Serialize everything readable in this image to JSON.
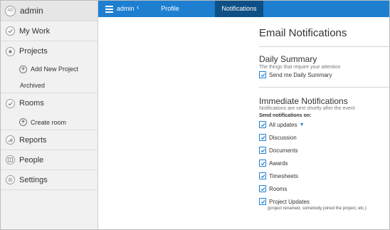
{
  "sidebar": {
    "user": {
      "avatar": "AD",
      "name": "admin"
    },
    "items": [
      {
        "label": "My Work",
        "icon": "check-icon"
      },
      {
        "label": "Projects",
        "icon": "projects-icon"
      },
      {
        "label": "Rooms",
        "icon": "check-icon"
      },
      {
        "label": "Reports",
        "icon": "reports-icon"
      },
      {
        "label": "People",
        "icon": "people-icon"
      },
      {
        "label": "Settings",
        "icon": "gear-icon"
      }
    ],
    "projects_sub": {
      "add": "Add New Project",
      "archived": "Archived"
    },
    "rooms_sub": {
      "create": "Create room"
    }
  },
  "topbar": {
    "user": "admin",
    "tabs": [
      {
        "label": "Profile"
      },
      {
        "label": "Notifications",
        "active": true
      }
    ],
    "accent": "#1e7fd0",
    "active_tab_color": "#0e4f85"
  },
  "main": {
    "title": "Email Notifications",
    "daily": {
      "title": "Daily Summary",
      "desc": "The things that require your attention",
      "option": {
        "label": "Send me Daily Summary",
        "checked": true
      }
    },
    "immediate": {
      "title": "Immediate Notifications",
      "desc": "Notifications are sent shortly after the event",
      "send_on": "Send notifications on:",
      "options": [
        {
          "label": "All updates",
          "checked": true
        },
        {
          "label": "Discussion",
          "checked": true
        },
        {
          "label": "Documents",
          "checked": true
        },
        {
          "label": "Awards",
          "checked": true
        },
        {
          "label": "Timesheets",
          "checked": true
        },
        {
          "label": "Rooms",
          "checked": true
        },
        {
          "label": "Project Updates",
          "checked": true
        }
      ],
      "project_updates_note": "(project renamed, somebody joined the project, etc.)"
    }
  }
}
